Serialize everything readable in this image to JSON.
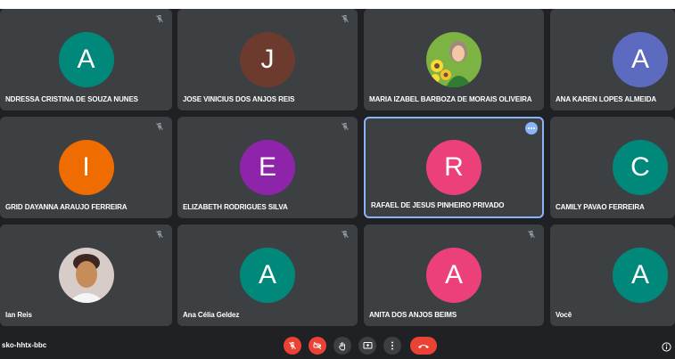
{
  "meeting": {
    "code": "sko-hhtx-bbc"
  },
  "colors": {
    "background": "#202124",
    "tile": "#3c4043",
    "active_border": "#8ab4f8",
    "danger": "#ea4335"
  },
  "participants": [
    {
      "name": "NDRESSA CRISTINA DE SOUZA NUNES",
      "initial": "A",
      "avatar_color": "#00897b",
      "muted": true
    },
    {
      "name": "JOSE VINICIUS DOS ANJOS REIS",
      "initial": "J",
      "avatar_color": "#6d3b2e",
      "muted": true
    },
    {
      "name": "MARIA IZABEL BARBOZA DE MORAIS OLIVEIRA",
      "initial": "",
      "avatar_color": "#7cb342",
      "muted": false,
      "photo": true
    },
    {
      "name": "ANA KAREN LOPES ALMEIDA",
      "initial": "A",
      "avatar_color": "#5c6bc0",
      "muted": false
    },
    {
      "name": "GRID DAYANNA ARAUJO FERREIRA",
      "initial": "I",
      "avatar_color": "#ef6c00",
      "muted": true
    },
    {
      "name": "ELIZABETH RODRIGUES SILVA",
      "initial": "E",
      "avatar_color": "#8e24aa",
      "muted": true
    },
    {
      "name": "RAFAEL DE JESUS PINHEIRO PRIVADO",
      "initial": "R",
      "avatar_color": "#ec407a",
      "muted": false,
      "active": true
    },
    {
      "name": "CAMILY PAVAO FERREIRA",
      "initial": "C",
      "avatar_color": "#00897b",
      "muted": false
    },
    {
      "name": "lan Reis",
      "initial": "",
      "avatar_color": "#b0855c",
      "muted": true,
      "photo": true
    },
    {
      "name": "Ana Célia Geldez",
      "initial": "A",
      "avatar_color": "#00897b",
      "muted": true
    },
    {
      "name": "ANITA DOS ANJOS BEIMS",
      "initial": "A",
      "avatar_color": "#ec407a",
      "muted": true
    },
    {
      "name": "Você",
      "initial": "A",
      "avatar_color": "#00897b",
      "muted": false
    }
  ],
  "controls": {
    "mic_icon": "mic-off-icon",
    "camera_icon": "camera-off-icon",
    "hand_icon": "raise-hand-icon",
    "present_icon": "present-screen-icon",
    "more_icon": "more-vert-icon",
    "hangup_icon": "hangup-icon",
    "info_icon": "info-icon"
  }
}
